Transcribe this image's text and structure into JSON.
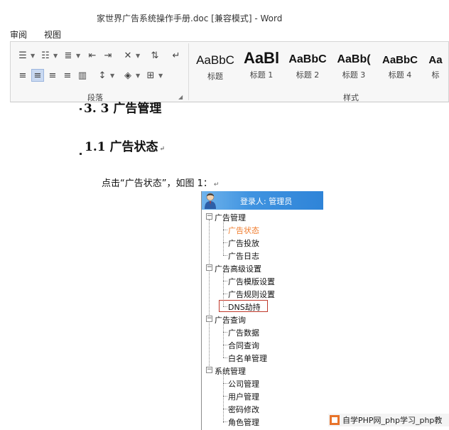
{
  "window": {
    "title": "家世界广告系统操作手册.doc [兼容模式] - Word"
  },
  "menu": {
    "tabs": [
      "审阅",
      "视图"
    ]
  },
  "ribbon": {
    "paragraph_group_label": "段落",
    "styles_group_label": "样式",
    "styles": [
      {
        "sample": "AaBbC",
        "name": "标题"
      },
      {
        "sample": "AaBl",
        "name": "标题 1"
      },
      {
        "sample": "AaBbC",
        "name": "标题 2"
      },
      {
        "sample": "AaBb(",
        "name": "标题 3"
      },
      {
        "sample": "AaBbC",
        "name": "标题 4"
      },
      {
        "sample": "Aa",
        "name": "标"
      }
    ]
  },
  "document": {
    "partial_heading": "3. 3 广告管理",
    "section_heading": "1.1 广告状态",
    "paragraph": "点击“广告状态”，如图 1：",
    "para_mark": "↵",
    "figure": {
      "login_label": "登录人: 管理员",
      "tree": {
        "group1": "广告管理",
        "item_ad_status": "广告状态",
        "item_ad_delivery": "广告投放",
        "item_ad_log": "广告日志",
        "group2": "广告高级设置",
        "item_template": "广告模版设置",
        "item_rules": "广告规则设置",
        "item_dns": "DNS劫持",
        "group3": "广告查询",
        "item_ad_data": "广告数据",
        "item_contract": "合同查询",
        "item_whitelist": "白名单管理",
        "group4": "系统管理",
        "item_company": "公司管理",
        "item_user": "用户管理",
        "item_password": "密码修改",
        "item_role": "角色管理"
      }
    }
  },
  "watermark": {
    "text": "自学PHP网_php学习_php教"
  },
  "colors": {
    "accent_blue": "#3f93e0",
    "current_item": "#f07a2a",
    "highlight_border": "#c0392b"
  }
}
